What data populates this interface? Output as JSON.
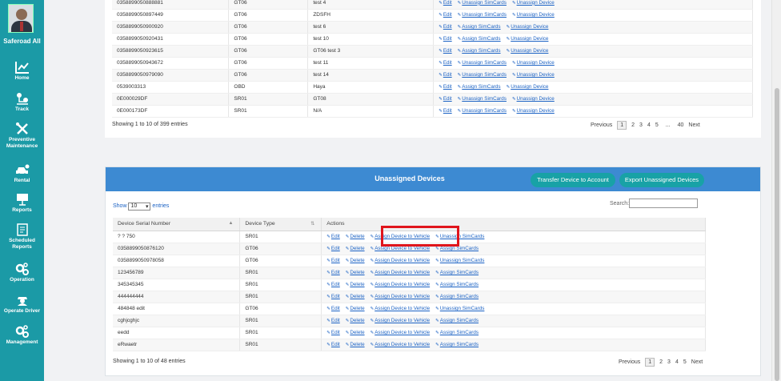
{
  "sidebar": {
    "user_name": "Saferoad All",
    "items": [
      {
        "label": "Home",
        "icon": "chart-icon"
      },
      {
        "label": "Track",
        "icon": "track-icon"
      },
      {
        "label": "Preventive Maintenance",
        "icon": "tools-icon"
      },
      {
        "label": "Rental",
        "icon": "car-icon"
      },
      {
        "label": "Reports",
        "icon": "presentation-icon"
      },
      {
        "label": "Scheduled Reports",
        "icon": "calendar-report-icon"
      },
      {
        "label": "Operation",
        "icon": "gears-icon"
      },
      {
        "label": "Operate Driver",
        "icon": "driver-icon"
      },
      {
        "label": "Management",
        "icon": "gears-icon"
      }
    ]
  },
  "top_table": {
    "rows": [
      {
        "serial": "0358899050888881",
        "type": "GT06",
        "name": "test 4",
        "actions": [
          "Edit",
          "Unassign SimCards",
          "Unassign Device"
        ]
      },
      {
        "serial": "0358899050897449",
        "type": "GT06",
        "name": "ZDSFH",
        "actions": [
          "Edit",
          "Unassign SimCards",
          "Unassign Device"
        ]
      },
      {
        "serial": "0358899050900920",
        "type": "GT06",
        "name": "test 6",
        "actions": [
          "Edit",
          "Assign SimCards",
          "Unassign Device"
        ]
      },
      {
        "serial": "0358899050920431",
        "type": "GT06",
        "name": "test 10",
        "actions": [
          "Edit",
          "Assign SimCards",
          "Unassign Device"
        ]
      },
      {
        "serial": "0358899050923615",
        "type": "GT06",
        "name": "GT06 test 3",
        "actions": [
          "Edit",
          "Assign SimCards",
          "Unassign Device"
        ]
      },
      {
        "serial": "0358899050943672",
        "type": "GT06",
        "name": "test 11",
        "actions": [
          "Edit",
          "Unassign SimCards",
          "Unassign Device"
        ]
      },
      {
        "serial": "0358899050979090",
        "type": "GT06",
        "name": "test 14",
        "actions": [
          "Edit",
          "Unassign SimCards",
          "Unassign Device"
        ]
      },
      {
        "serial": "0539003313",
        "type": "OBD",
        "name": "Haya",
        "actions": [
          "Edit",
          "Assign SimCards",
          "Unassign Device"
        ]
      },
      {
        "serial": "0E000029DF",
        "type": "SR01",
        "name": "GT08",
        "actions": [
          "Edit",
          "Unassign SimCards",
          "Unassign Device"
        ]
      },
      {
        "serial": "0E000173DF",
        "type": "SR01",
        "name": "N/A",
        "actions": [
          "Edit",
          "Unassign SimCards",
          "Unassign Device"
        ]
      }
    ],
    "info": "Showing 1 to 10 of 399 entries",
    "pager": {
      "prev": "Previous",
      "pages": [
        "1",
        "2",
        "3",
        "4",
        "5",
        "...",
        "40"
      ],
      "next": "Next"
    }
  },
  "unassigned": {
    "title": "Unassigned Devices",
    "transfer_button": "Transfer Device to Account",
    "export_button": "Export Unassigned Devices",
    "show_label": "Show",
    "show_value": "10",
    "entries_label": "entries",
    "search_label": "Search:",
    "columns": [
      "Device Serial Number",
      "Device Type",
      "Actions"
    ],
    "rows": [
      {
        "serial": "? ? 750",
        "type": "SR01",
        "sim_action": "Unassign SimCards"
      },
      {
        "serial": "0358899050876120",
        "type": "GT06",
        "sim_action": "Assign SimCards"
      },
      {
        "serial": "0358899050978058",
        "type": "GT06",
        "sim_action": "Unassign SimCards"
      },
      {
        "serial": "123456789",
        "type": "SR01",
        "sim_action": "Assign SimCards"
      },
      {
        "serial": "345345345",
        "type": "SR01",
        "sim_action": "Assign SimCards"
      },
      {
        "serial": "444444444",
        "type": "SR01",
        "sim_action": "Assign SimCards"
      },
      {
        "serial": "484848 edit",
        "type": "GT06",
        "sim_action": "Unassign SimCards"
      },
      {
        "serial": "cghjcghjc",
        "type": "SR01",
        "sim_action": "Assign SimCards"
      },
      {
        "serial": "eedd",
        "type": "SR01",
        "sim_action": "Assign SimCards"
      },
      {
        "serial": "eRwaetr",
        "type": "SR01",
        "sim_action": "Assign SimCards"
      }
    ],
    "row_actions": {
      "edit": "Edit",
      "delete": "Delete",
      "assign": "Assign Device to Vehicle"
    },
    "info": "Showing 1 to 10 of 48 entries",
    "pager": {
      "prev": "Previous",
      "pages": [
        "1",
        "2",
        "3",
        "4",
        "5"
      ],
      "next": "Next"
    }
  },
  "colors": {
    "sidebar": "#1b9aa6",
    "header": "#3d8ad2",
    "button": "#18a2a6",
    "link": "#1b62c4",
    "highlight": "#e0151c"
  }
}
